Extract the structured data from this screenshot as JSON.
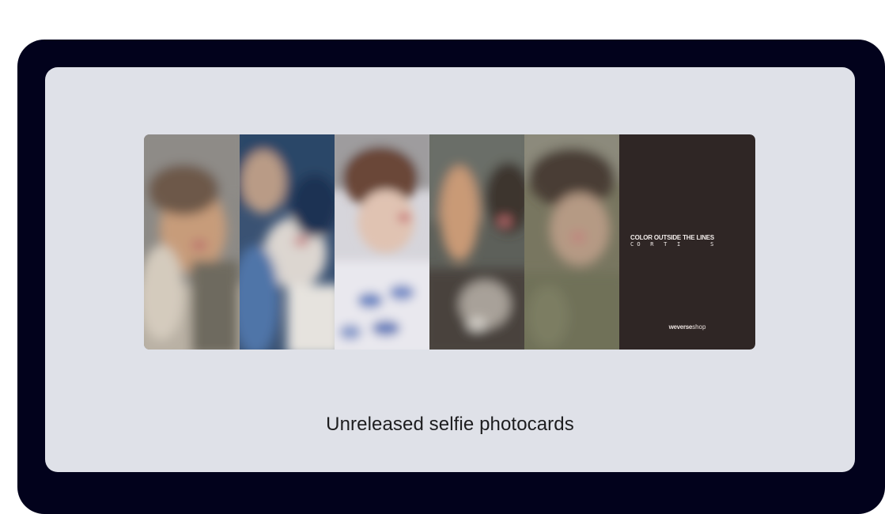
{
  "caption": "Unreleased selfie photocards",
  "photocards": [
    {
      "name": "photocard-1",
      "palette": [
        "#8a8378",
        "#c7a07e",
        "#6f6a63"
      ]
    },
    {
      "name": "photocard-2",
      "palette": [
        "#2f4f7a",
        "#d9cfc6",
        "#5879a8"
      ]
    },
    {
      "name": "photocard-3",
      "palette": [
        "#d8d6dc",
        "#6d4a3e",
        "#7c8fc7"
      ]
    },
    {
      "name": "photocard-4",
      "palette": [
        "#5b5e58",
        "#caa17d",
        "#3e3933"
      ]
    },
    {
      "name": "photocard-5",
      "palette": [
        "#74735f",
        "#b99a80",
        "#463d35"
      ]
    }
  ],
  "back_card": {
    "title": "COLOR OUTSIDE THE LINES",
    "artist_spaced": "C O   R   T   I         S",
    "logo_brand": "weverse",
    "logo_suffix": "shop",
    "background": "#2f2625"
  },
  "colors": {
    "frame": "#02021c",
    "screen": "#dfe1e8",
    "caption_text": "#1d1d1f"
  }
}
